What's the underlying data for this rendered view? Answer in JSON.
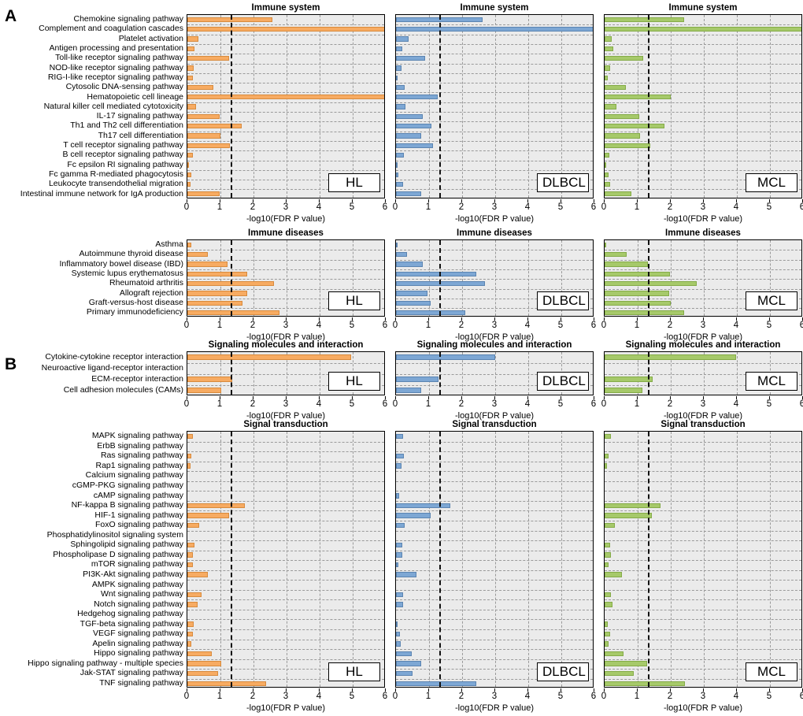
{
  "figure": {
    "panel_letters": [
      "A",
      "B"
    ],
    "groups": [
      "HL",
      "DLBCL",
      "MCL"
    ],
    "colors": {
      "HL": "#f7ab62",
      "DLBCL": "#7da7d4",
      "MCL": "#a6c96a"
    },
    "xlabel": "-log10(FDR P value)",
    "xlim": [
      0,
      6
    ],
    "xticks": [
      0,
      1,
      2,
      3,
      4,
      5,
      6
    ],
    "threshold": 1.3,
    "plot_bg": "#ebebeb",
    "grid": true
  },
  "chart_data": [
    {
      "id": "immune-system",
      "type": "bar",
      "orientation": "horizontal",
      "title": "Immune system",
      "xlabel": "-log10(FDR P value)",
      "ylabel": "",
      "xlim": [
        0,
        6
      ],
      "xticks": [
        0,
        1,
        2,
        3,
        4,
        5,
        6
      ],
      "threshold": 1.3,
      "categories": [
        "Chemokine signaling pathway",
        "Complement and coagulation cascades",
        "Platelet activation",
        "Antigen processing and presentation",
        "Toll-like receptor signaling pathway",
        "NOD-like receptor signaling pathway",
        "RIG-I-like receptor signaling pathway",
        "Cytosolic DNA-sensing pathway",
        "Hematopoietic cell lineage",
        "Natural killer cell mediated cytotoxicity",
        "IL-17 signaling pathway",
        "Th1 and Th2 cell differentiation",
        "Th17 cell differentiation",
        "T cell receptor signaling pathway",
        "B cell receptor signaling pathway",
        "Fc epsilon RI signaling pathway",
        "Fc gamma R-mediated phagocytosis",
        "Leukocyte transendothelial migration",
        "Intestinal immune network for IgA production"
      ],
      "series": [
        {
          "name": "HL",
          "values": [
            2.58,
            6.0,
            0.33,
            0.21,
            1.26,
            0.2,
            0.17,
            0.79,
            6.0,
            0.27,
            0.97,
            1.65,
            1.0,
            1.28,
            0.16,
            0.03,
            0.13,
            0.1,
            0.98
          ]
        },
        {
          "name": "DLBCL",
          "values": [
            2.62,
            6.0,
            0.37,
            0.19,
            0.89,
            0.16,
            0.05,
            0.27,
            1.27,
            0.28,
            0.82,
            1.07,
            0.75,
            1.12,
            0.24,
            0.04,
            0.07,
            0.22,
            0.76
          ]
        },
        {
          "name": "MCL",
          "values": [
            2.4,
            6.0,
            0.22,
            0.27,
            1.16,
            0.17,
            0.1,
            0.64,
            2.0,
            0.36,
            1.04,
            1.8,
            1.07,
            1.38,
            0.14,
            0.02,
            0.13,
            0.17,
            0.8
          ]
        }
      ]
    },
    {
      "id": "immune-diseases",
      "type": "bar",
      "orientation": "horizontal",
      "title": "Immune diseases",
      "xlabel": "-log10(FDR P value)",
      "ylabel": "",
      "xlim": [
        0,
        6
      ],
      "xticks": [
        0,
        1,
        2,
        3,
        4,
        5,
        6
      ],
      "threshold": 1.3,
      "categories": [
        "Asthma",
        "Autoimmune thyroid disease",
        "Inflammatory bowel disease (IBD)",
        "Systemic lupus erythematosus",
        "Rheumatoid arthritis",
        "Allograft rejection",
        "Graft-versus-host disease",
        "Primary immunodeficiency"
      ],
      "series": [
        {
          "name": "HL",
          "values": [
            0.12,
            0.62,
            1.22,
            1.8,
            2.62,
            1.8,
            1.67,
            2.78
          ]
        },
        {
          "name": "DLBCL",
          "values": [
            0.04,
            0.33,
            0.81,
            2.42,
            2.7,
            0.96,
            1.04,
            2.1
          ]
        },
        {
          "name": "MCL",
          "values": [
            0.05,
            0.66,
            1.3,
            1.97,
            2.78,
            1.95,
            2.0,
            2.4
          ]
        }
      ]
    },
    {
      "id": "signaling-molecules-and-interaction",
      "type": "bar",
      "orientation": "horizontal",
      "title": "Signaling molecules and interaction",
      "xlabel": "-log10(FDR P value)",
      "ylabel": "",
      "xlim": [
        0,
        6
      ],
      "xticks": [
        0,
        1,
        2,
        3,
        4,
        5,
        6
      ],
      "threshold": 1.3,
      "categories": [
        "Cytokine-cytokine receptor interaction",
        "Neuroactive ligand-receptor interaction",
        "ECM-receptor interaction",
        "Cell adhesion molecules (CAMs)"
      ],
      "series": [
        {
          "name": "HL",
          "values": [
            4.95,
            0.0,
            1.36,
            1.02
          ]
        },
        {
          "name": "DLBCL",
          "values": [
            3.0,
            0.0,
            1.28,
            0.77
          ]
        },
        {
          "name": "MCL",
          "values": [
            3.98,
            0.0,
            1.45,
            1.14
          ]
        }
      ]
    },
    {
      "id": "signal-transduction",
      "type": "bar",
      "orientation": "horizontal",
      "title": "Signal transduction",
      "xlabel": "-log10(FDR P value)",
      "ylabel": "",
      "xlim": [
        0,
        6
      ],
      "xticks": [
        0,
        1,
        2,
        3,
        4,
        5,
        6
      ],
      "threshold": 1.3,
      "categories": [
        "MAPK signaling pathway",
        "ErbB signaling pathway",
        "Ras signaling pathway",
        "Rap1 signaling pathway",
        "Calcium signaling pathway",
        "cGMP-PKG signaling pathway",
        "cAMP signaling pathway",
        "NF-kappa B signaling pathway",
        "HIF-1 signaling pathway",
        "FoxO signaling pathway",
        "Phosphatidylinositol signaling system",
        "Sphingolipid signaling pathway",
        "Phospholipase D signaling pathway",
        "mTOR signaling pathway",
        "PI3K-Akt signaling pathway",
        "AMPK signaling pathway",
        "Wnt signaling pathway",
        "Notch signaling pathway",
        "Hedgehog signaling pathway",
        "TGF-beta signaling pathway",
        "VEGF signaling pathway",
        "Apelin signaling pathway",
        "Hippo signaling pathway",
        "Hippo signaling pathway - multiple species",
        "Jak-STAT signaling pathway",
        "TNF signaling pathway"
      ],
      "series": [
        {
          "name": "HL",
          "values": [
            0.17,
            0.0,
            0.11,
            0.09,
            0.0,
            0.0,
            0.0,
            1.73,
            1.25,
            0.35,
            0.0,
            0.21,
            0.17,
            0.16,
            0.61,
            0.0,
            0.44,
            0.3,
            0.0,
            0.2,
            0.17,
            0.12,
            0.74,
            1.03,
            0.93,
            2.38
          ]
        },
        {
          "name": "DLBCL",
          "values": [
            0.22,
            0.0,
            0.23,
            0.17,
            0.0,
            0.0,
            0.1,
            1.65,
            1.04,
            0.26,
            0.0,
            0.2,
            0.18,
            0.08,
            0.62,
            0.0,
            0.21,
            0.22,
            0.0,
            0.05,
            0.11,
            0.14,
            0.48,
            0.76,
            0.51,
            2.42
          ]
        },
        {
          "name": "MCL",
          "values": [
            0.19,
            0.0,
            0.13,
            0.06,
            0.0,
            0.0,
            0.0,
            1.7,
            1.44,
            0.31,
            0.0,
            0.17,
            0.2,
            0.11,
            0.52,
            0.0,
            0.18,
            0.23,
            0.0,
            0.1,
            0.16,
            0.13,
            0.56,
            1.28,
            0.87,
            2.42
          ]
        }
      ]
    }
  ]
}
